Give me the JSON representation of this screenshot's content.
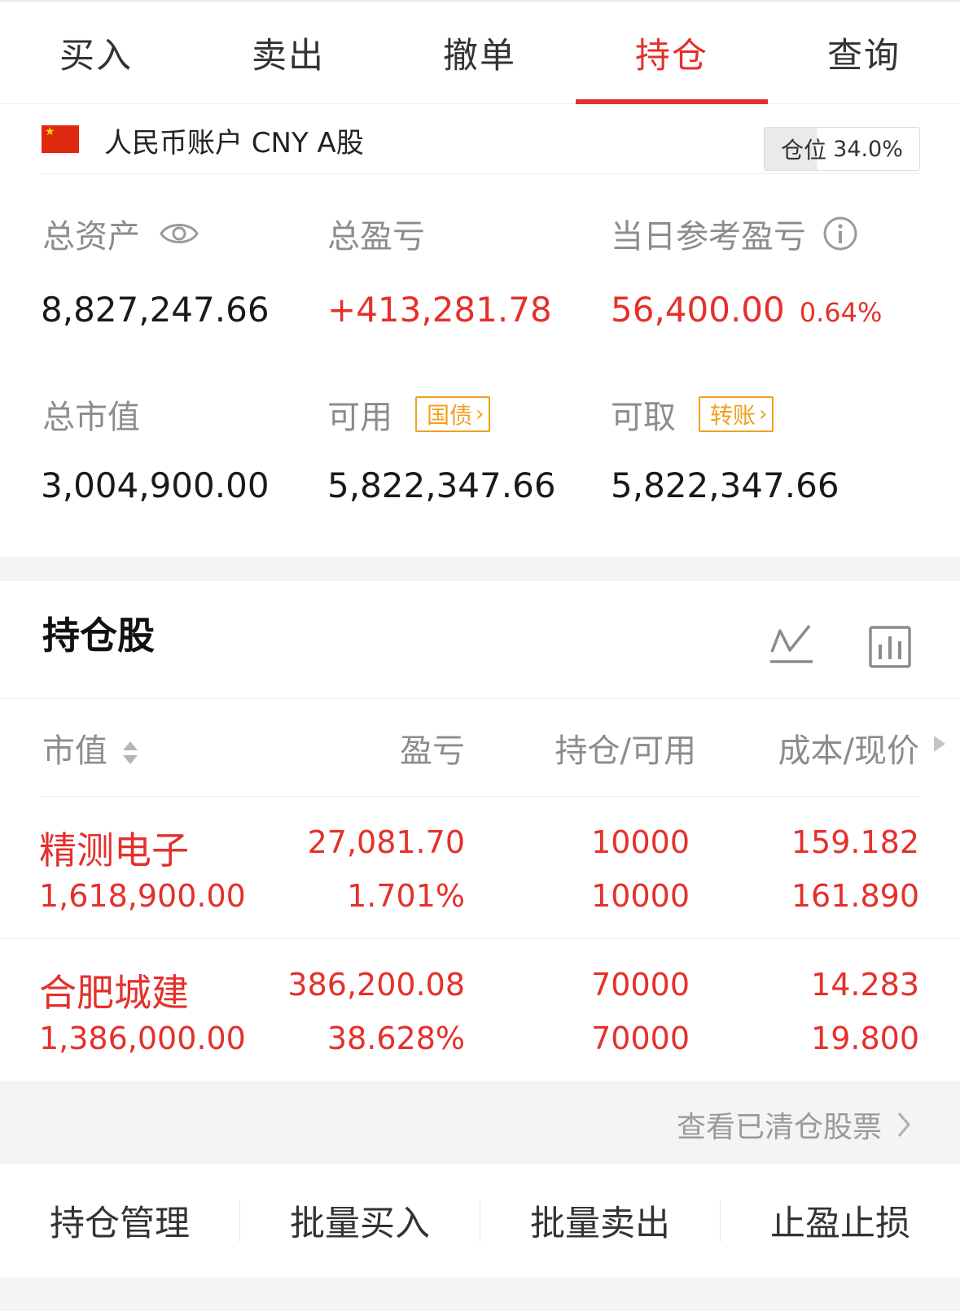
{
  "tabs": [
    {
      "label": "买入",
      "active": false
    },
    {
      "label": "卖出",
      "active": false
    },
    {
      "label": "撤单",
      "active": false
    },
    {
      "label": "持仓",
      "active": true
    },
    {
      "label": "查询",
      "active": false
    }
  ],
  "account": {
    "flag_icon": "china-flag-icon",
    "label": "人民币账户 CNY A股",
    "position_label": "仓位",
    "position_value": "34.0%",
    "position_ratio": 0.34
  },
  "summary": {
    "total_assets_label": "总资产",
    "total_assets_value": "8,827,247.66",
    "total_pnl_label": "总盈亏",
    "total_pnl_value": "+413,281.78",
    "daily_pnl_label": "当日参考盈亏",
    "daily_pnl_value": "56,400.00",
    "daily_pnl_pct": "0.64%",
    "market_value_label": "总市值",
    "market_value_value": "3,004,900.00",
    "available_label": "可用",
    "available_tag": "国债",
    "available_value": "5,822,347.66",
    "withdrawable_label": "可取",
    "withdrawable_tag": "转账",
    "withdrawable_value": "5,822,347.66"
  },
  "holdings": {
    "title": "持仓股",
    "columns": [
      "市值",
      "盈亏",
      "持仓/可用",
      "成本/现价"
    ],
    "rows": [
      {
        "name": "精测电子",
        "market_value": "1,618,900.00",
        "pnl": "27,081.70",
        "pnl_pct": "1.701%",
        "position": "10000",
        "available": "10000",
        "cost": "159.182",
        "price": "161.890"
      },
      {
        "name": "合肥城建",
        "market_value": "1,386,000.00",
        "pnl": "386,200.08",
        "pnl_pct": "38.628%",
        "position": "70000",
        "available": "70000",
        "cost": "14.283",
        "price": "19.800"
      }
    ],
    "cleared_link": "查看已清仓股票"
  },
  "actions": [
    "持仓管理",
    "批量买入",
    "批量卖出",
    "止盈止损"
  ],
  "colors": {
    "accent_red": "#e5302b",
    "tag_orange": "#f0a020",
    "label_gray": "#8c8c8c"
  }
}
